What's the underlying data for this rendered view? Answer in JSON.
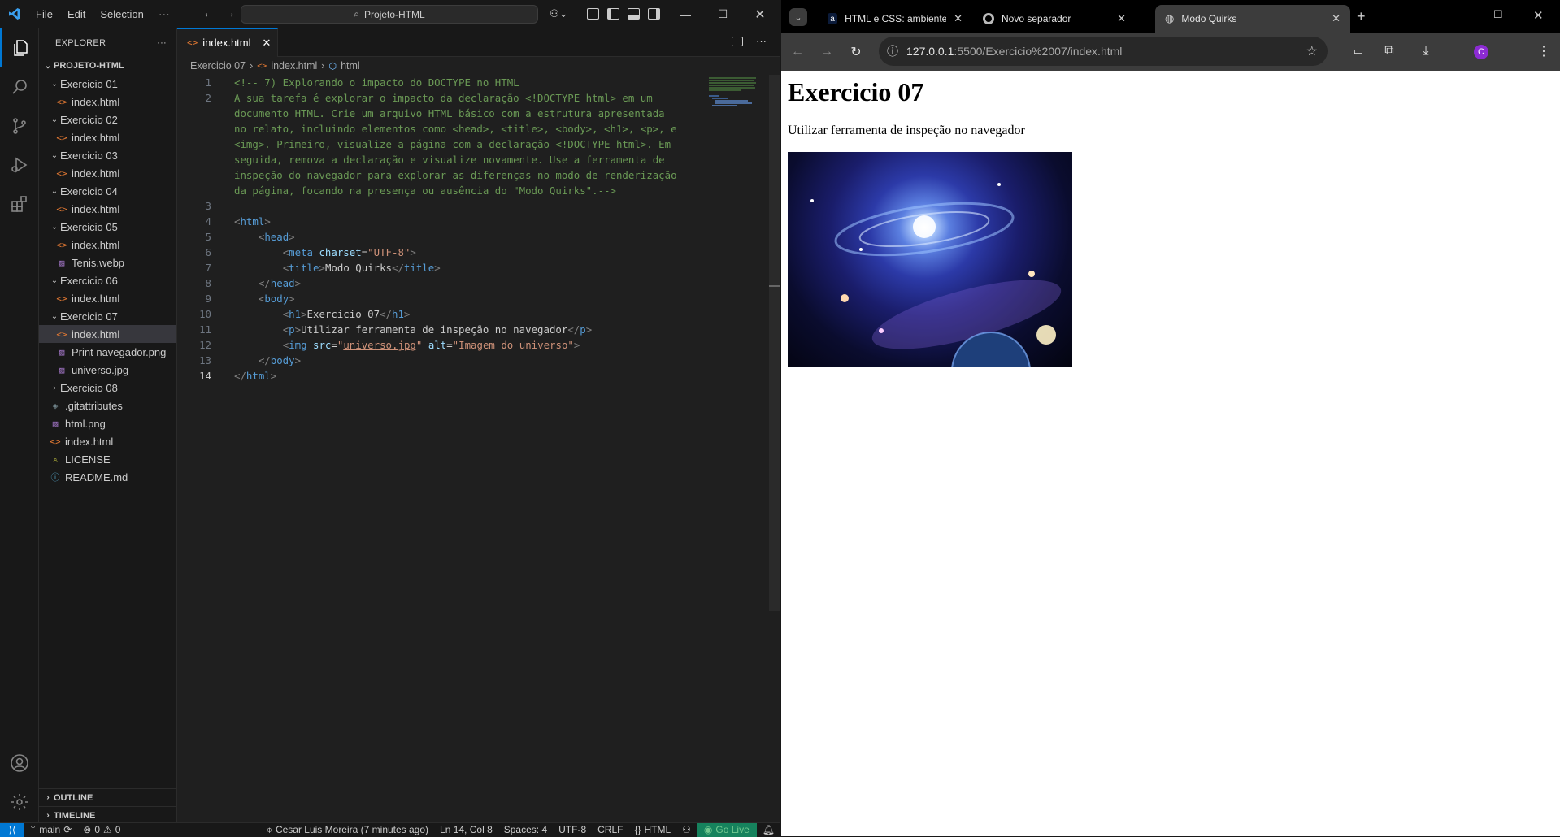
{
  "vscode": {
    "menu": [
      "File",
      "Edit",
      "Selection"
    ],
    "menu_more": "···",
    "command_center": "Projeto-HTML",
    "explorer_title": "EXPLORER",
    "explorer_more": "···",
    "project_name": "PROJETO-HTML",
    "tree": [
      {
        "label": "Exercicio 01",
        "type": "folder",
        "indent": 1
      },
      {
        "label": "index.html",
        "type": "html",
        "indent": 2
      },
      {
        "label": "Exercicio 02",
        "type": "folder",
        "indent": 1
      },
      {
        "label": "index.html",
        "type": "html",
        "indent": 2
      },
      {
        "label": "Exercicio 03",
        "type": "folder",
        "indent": 1
      },
      {
        "label": "index.html",
        "type": "html",
        "indent": 2
      },
      {
        "label": "Exercicio 04",
        "type": "folder",
        "indent": 1
      },
      {
        "label": "index.html",
        "type": "html",
        "indent": 2
      },
      {
        "label": "Exercicio 05",
        "type": "folder",
        "indent": 1
      },
      {
        "label": "index.html",
        "type": "html",
        "indent": 2
      },
      {
        "label": "Tenis.webp",
        "type": "img",
        "indent": 2
      },
      {
        "label": "Exercicio 06",
        "type": "folder",
        "indent": 1
      },
      {
        "label": "index.html",
        "type": "html",
        "indent": 2
      },
      {
        "label": "Exercicio 07",
        "type": "folder",
        "indent": 1
      },
      {
        "label": "index.html",
        "type": "html",
        "indent": 2,
        "selected": true
      },
      {
        "label": "Print navegador.png",
        "type": "img",
        "indent": 2
      },
      {
        "label": "universo.jpg",
        "type": "img",
        "indent": 2
      },
      {
        "label": "Exercicio 08",
        "type": "folder-closed",
        "indent": 1
      },
      {
        "label": ".gitattributes",
        "type": "git",
        "indent": 1
      },
      {
        "label": "html.png",
        "type": "img",
        "indent": 1
      },
      {
        "label": "index.html",
        "type": "html",
        "indent": 1
      },
      {
        "label": "LICENSE",
        "type": "license",
        "indent": 1
      },
      {
        "label": "README.md",
        "type": "info",
        "indent": 1
      }
    ],
    "outline_label": "OUTLINE",
    "timeline_label": "TIMELINE",
    "tab_label": "index.html",
    "breadcrumb": [
      "Exercicio 07",
      "index.html",
      "html"
    ],
    "active_line": 14,
    "code_lines": [
      [
        [
          "c-com",
          "<!-- 7) Explorando o impacto do DOCTYPE no HTML"
        ]
      ],
      [
        [
          "c-com",
          "A sua tarefa é explorar o impacto da declaração <!DOCTYPE html> em um"
        ]
      ],
      [
        [
          "c-com",
          "documento HTML. Crie um arquivo HTML básico com a estrutura apresentada"
        ]
      ],
      [
        [
          "c-com",
          "no relato, incluindo elementos como <head>, <title>, <body>, <h1>, <p>, e"
        ]
      ],
      [
        [
          "c-com",
          "<img>. Primeiro, visualize a página com a declaração <!DOCTYPE html>. Em"
        ]
      ],
      [
        [
          "c-com",
          "seguida, remova a declaração e visualize novamente. Use a ferramenta de"
        ]
      ],
      [
        [
          "c-com",
          "inspeção do navegador para explorar as diferenças no modo de renderização"
        ]
      ],
      [
        [
          "c-com",
          "da página, focando na presença ou ausência do \"Modo Quirks\".-->"
        ]
      ],
      [],
      [
        [
          "c-br",
          "<"
        ],
        [
          "c-tag",
          "html"
        ],
        [
          "c-br",
          ">"
        ]
      ],
      [
        [
          "",
          "    "
        ],
        [
          "c-br",
          "<"
        ],
        [
          "c-tag",
          "head"
        ],
        [
          "c-br",
          ">"
        ]
      ],
      [
        [
          "",
          "        "
        ],
        [
          "c-br",
          "<"
        ],
        [
          "c-tag",
          "meta"
        ],
        [
          "",
          " "
        ],
        [
          "c-att",
          "charset"
        ],
        [
          "",
          "="
        ],
        [
          "c-str",
          "\"UTF-8\""
        ],
        [
          "c-br",
          ">"
        ]
      ],
      [
        [
          "",
          "        "
        ],
        [
          "c-br",
          "<"
        ],
        [
          "c-tag",
          "title"
        ],
        [
          "c-br",
          ">"
        ],
        [
          "",
          "Modo Quirks"
        ],
        [
          "c-br",
          "</"
        ],
        [
          "c-tag",
          "title"
        ],
        [
          "c-br",
          ">"
        ]
      ],
      [
        [
          "",
          "    "
        ],
        [
          "c-br",
          "</"
        ],
        [
          "c-tag",
          "head"
        ],
        [
          "c-br",
          ">"
        ]
      ],
      [
        [
          "",
          "    "
        ],
        [
          "c-br",
          "<"
        ],
        [
          "c-tag",
          "body"
        ],
        [
          "c-br",
          ">"
        ]
      ],
      [
        [
          "",
          "        "
        ],
        [
          "c-br",
          "<"
        ],
        [
          "c-tag",
          "h1"
        ],
        [
          "c-br",
          ">"
        ],
        [
          "",
          "Exercicio 07"
        ],
        [
          "c-br",
          "</"
        ],
        [
          "c-tag",
          "h1"
        ],
        [
          "c-br",
          ">"
        ]
      ],
      [
        [
          "",
          "        "
        ],
        [
          "c-br",
          "<"
        ],
        [
          "c-tag",
          "p"
        ],
        [
          "c-br",
          ">"
        ],
        [
          "",
          "Utilizar ferramenta de inspeção no navegador"
        ],
        [
          "c-br",
          "</"
        ],
        [
          "c-tag",
          "p"
        ],
        [
          "c-br",
          ">"
        ]
      ],
      [
        [
          "",
          "        "
        ],
        [
          "c-br",
          "<"
        ],
        [
          "c-tag",
          "img"
        ],
        [
          "",
          " "
        ],
        [
          "c-att",
          "src"
        ],
        [
          "",
          "="
        ],
        [
          "c-str",
          "\""
        ],
        [
          "c-link",
          "universo.jpg"
        ],
        [
          "c-str",
          "\""
        ],
        [
          "",
          " "
        ],
        [
          "c-att",
          "alt"
        ],
        [
          "",
          "="
        ],
        [
          "c-str",
          "\"Imagem do universo\""
        ],
        [
          "c-br",
          ">"
        ]
      ],
      [
        [
          "",
          "    "
        ],
        [
          "c-br",
          "</"
        ],
        [
          "c-tag",
          "body"
        ],
        [
          "c-br",
          ">"
        ]
      ],
      [
        [
          "c-br",
          "</"
        ],
        [
          "c-tag",
          "html"
        ],
        [
          "c-br",
          ">"
        ]
      ]
    ],
    "line_numbers": [
      "1",
      "2",
      "",
      "",
      "",
      "",
      "",
      "",
      "3",
      "4",
      "5",
      "6",
      "7",
      "8",
      "9",
      "10",
      "11",
      "12",
      "13",
      "14"
    ],
    "status": {
      "branch": "main",
      "problems": "0",
      "warnings": "0",
      "blame": "Cesar Luis Moreira (7 minutes ago)",
      "position": "Ln 14, Col 8",
      "spaces": "Spaces: 4",
      "encoding": "UTF-8",
      "eol": "CRLF",
      "language": "HTML",
      "golive": "Go Live"
    }
  },
  "chrome": {
    "tabs": [
      {
        "label": "HTML e CSS: ambientes de de"
      },
      {
        "label": "Novo separador"
      },
      {
        "label": "Modo Quirks",
        "active": true
      }
    ],
    "url_host": "127.0.0.1",
    "url_rest": ":5500/Exercicio%2007/index.html",
    "profile_initial": "C",
    "page": {
      "h1": "Exercicio 07",
      "p": "Utilizar ferramenta de inspeção no navegador",
      "img_alt": "Imagem do universo"
    }
  },
  "colors": {
    "vscode_bg": "#1f1f1f",
    "accent": "#0078d4",
    "golive": "#16825d",
    "chrome_toolbar": "#3c3c3c"
  }
}
